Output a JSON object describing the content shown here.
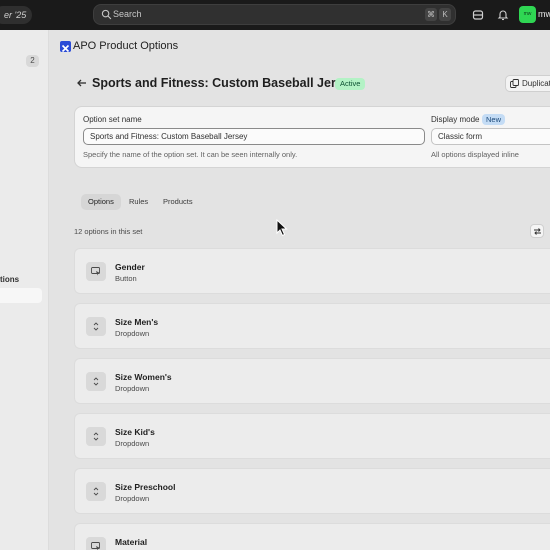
{
  "topbar": {
    "pill_text": "er '25",
    "search_placeholder": "Search",
    "kbd_cmd": "⌘",
    "kbd_k": "K",
    "avatar_initials": "mw",
    "user_name": "mw"
  },
  "sidebar": {
    "badge_count": "2",
    "section_label": "tions"
  },
  "app": {
    "title": "APO Product Options"
  },
  "page": {
    "title": "Sports and Fitness: Custom Baseball Jersey",
    "status": "Active",
    "duplicate_label": "Duplicate"
  },
  "form": {
    "name_label": "Option set name",
    "name_value": "Sports and Fitness: Custom Baseball Jersey",
    "name_help": "Specify the name of the option set. It can be seen internally only.",
    "mode_label": "Display mode",
    "mode_badge": "New",
    "mode_value": "Classic form",
    "mode_help": "All options displayed inline"
  },
  "tabs": [
    {
      "label": "Options",
      "active": true
    },
    {
      "label": "Rules",
      "active": false
    },
    {
      "label": "Products",
      "active": false
    }
  ],
  "list": {
    "count_text": "12 options in this set",
    "options": [
      {
        "name": "Gender",
        "type": "Button",
        "icon": "button-icon"
      },
      {
        "name": "Size Men's",
        "type": "Dropdown",
        "icon": "dropdown-icon"
      },
      {
        "name": "Size Women's",
        "type": "Dropdown",
        "icon": "dropdown-icon"
      },
      {
        "name": "Size Kid's",
        "type": "Dropdown",
        "icon": "dropdown-icon"
      },
      {
        "name": "Size Preschool",
        "type": "Dropdown",
        "icon": "dropdown-icon"
      },
      {
        "name": "Material",
        "type": "Dropdown",
        "icon": "button-icon"
      }
    ]
  },
  "colors": {
    "topbar": "#1a1a1a",
    "active_badge_bg": "#b3f2c5",
    "new_badge_bg": "#c4dcf5",
    "avatar": "#2fd653",
    "app_logo": "#2a4bd6"
  }
}
